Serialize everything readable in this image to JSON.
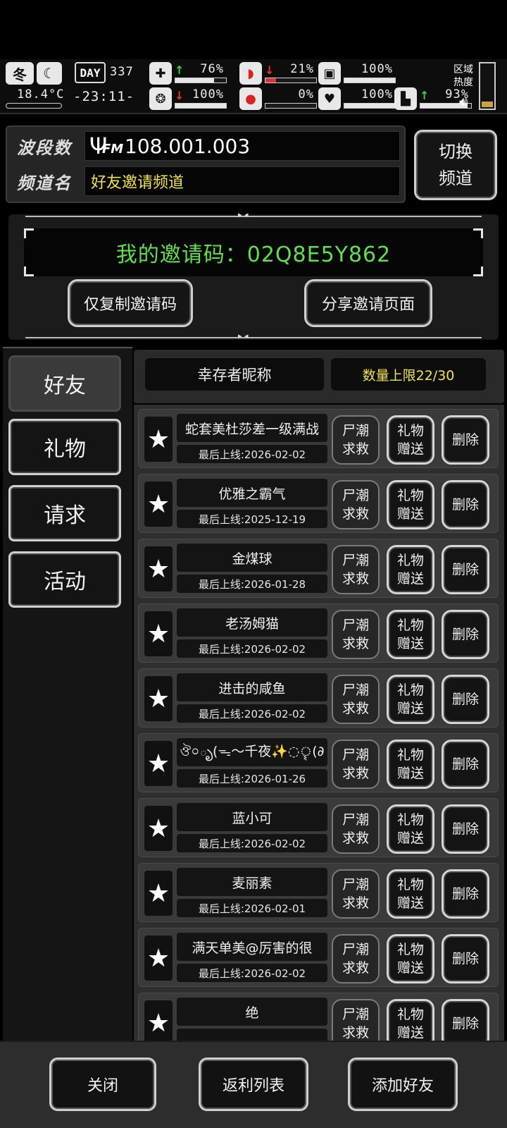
{
  "status": {
    "season": "冬",
    "temperature": "18.4°C",
    "day_label": "DAY",
    "day_number": "337",
    "clock": "-23:11-",
    "zone_label_1": "区域",
    "zone_label_2": "热度",
    "stats": [
      {
        "icon": "medkit-icon",
        "trend": "up",
        "value": "76%",
        "level": 0.76
      },
      {
        "icon": "stomach-icon",
        "trend": "down",
        "value": "21%",
        "level": 0.21
      },
      {
        "icon": "water-icon",
        "trend": "none",
        "value": "100%",
        "level": 1.0
      },
      {
        "icon": "brain-icon",
        "trend": "down",
        "value": "100%",
        "level": 1.0
      },
      {
        "icon": "blood-icon",
        "trend": "none",
        "value": "0%",
        "level": 0.0
      },
      {
        "icon": "heart-icon",
        "trend": "none",
        "value": "100%",
        "level": 1.0
      },
      {
        "icon": "boot-icon",
        "trend": "up",
        "value": "93%",
        "level": 0.93
      }
    ]
  },
  "radio": {
    "band_label": "波段数",
    "band_value": "108.001.003",
    "fm_label": "FM",
    "channel_label": "频道名",
    "channel_value": "好友邀请频道",
    "switch_line1": "切换",
    "switch_line2": "频道"
  },
  "invite": {
    "code_text": "我的邀请码：02Q8E5Y862",
    "copy_button": "仅复制邀请码",
    "share_button": "分享邀请页面"
  },
  "tabs": [
    "好友",
    "礼物",
    "请求",
    "活动"
  ],
  "list_header": {
    "nickname": "幸存者昵称",
    "limit": "数量上限22/30"
  },
  "row_buttons": {
    "rescue_1": "尸潮",
    "rescue_2": "求救",
    "gift_1": "礼物",
    "gift_2": "赠送",
    "delete": "删除"
  },
  "friends": [
    {
      "name": "蛇套美杜莎差一级满战",
      "last_online": "最后上线:2026-02-02"
    },
    {
      "name": "优雅之霸气",
      "last_online": "最后上线:2025-12-19"
    },
    {
      "name": "金煤球",
      "last_online": "最后上线:2026-01-28"
    },
    {
      "name": "老汤姆猫",
      "last_online": "最后上线:2026-02-02"
    },
    {
      "name": "进击的咸鱼",
      "last_online": "最后上线:2026-02-02"
    },
    {
      "name": "ঔ০ృ(ᯓ〜千夜✨◌ৄ(∂",
      "last_online": "最后上线:2026-01-26"
    },
    {
      "name": "蓝小可",
      "last_online": "最后上线:2026-02-02"
    },
    {
      "name": "麦丽素",
      "last_online": "最后上线:2026-02-01"
    },
    {
      "name": "满天单美@厉害的很",
      "last_online": "最后上线:2026-02-02"
    },
    {
      "name": "绝",
      "last_online": ""
    }
  ],
  "bottom": {
    "close": "关闭",
    "rebate": "返利列表",
    "add_friend": "添加好友"
  }
}
